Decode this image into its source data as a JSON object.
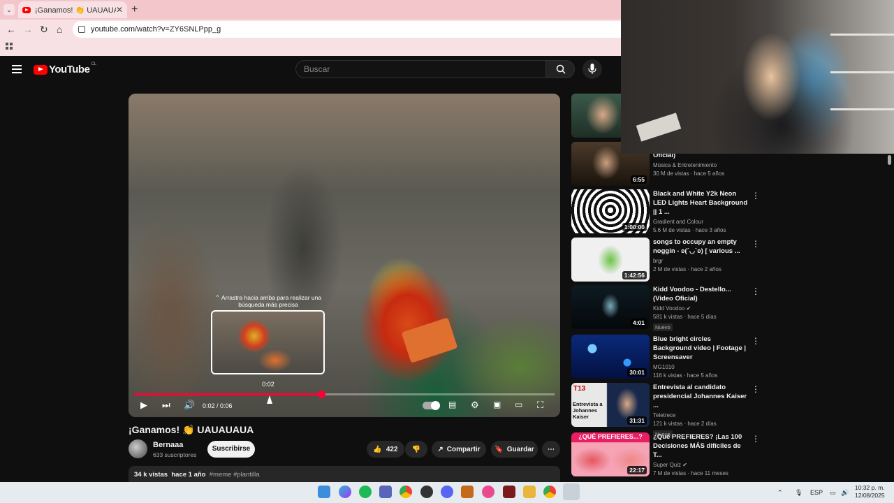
{
  "browser": {
    "tab_title": "¡Ganamos! 👏 UAUAUAUA - YouTube",
    "tab_close": "✕",
    "new_tab": "+",
    "url": "youtube.com/watch?v=ZY6SNLPpp_g"
  },
  "header": {
    "logo_text": "YouTube",
    "country": "CL",
    "search_placeholder": "Buscar"
  },
  "player": {
    "drag_hint": "⌃ Arrastra hacia arriba para realizar una búsqueda más precisa",
    "hover_time": "0:02",
    "timecode": "0:02 / 0:06",
    "progress": 0.445
  },
  "video": {
    "title": "¡Ganamos! 👏 UAUAUAUA",
    "channel": "Bernaaa",
    "subscribers": "633 suscriptores",
    "subscribe_label": "Suscribirse",
    "likes": "422",
    "share_label": "Compartir",
    "save_label": "Guardar",
    "views": "34 k vistas",
    "age": "hace 1 año",
    "tags": "#meme #plantilla"
  },
  "sidebar": [
    {
      "title": "Oficial)",
      "channel": "Música & Entretenimiento",
      "views": "30 M de vistas · hace 5 años",
      "duration": "6:55",
      "badge": "",
      "partial": true
    },
    {
      "title": "Black and White Y2k Neon LED Lights Heart Background || 1 ...",
      "channel": "Gradient and Colour",
      "views": "5.6 M de vistas · hace 3 años",
      "duration": "1:00:00",
      "badge": ""
    },
    {
      "title": "songs to occupy an empty noggin - ʚ(´◡`ʚ) [ various ...",
      "channel": "brgr",
      "views": "2 M de vistas · hace 2 años",
      "duration": "1:42:56",
      "badge": ""
    },
    {
      "title": "Kidd Voodoo - Destello... (Video Oficial)",
      "channel": "Kidd Voodoo ✔",
      "views": "581 k vistas · hace 5 días",
      "duration": "4:01",
      "badge": "Nuevo"
    },
    {
      "title": "Blue bright circles Background video | Footage | Screensaver",
      "channel": "MG1010",
      "views": "116 k vistas · hace 5 años",
      "duration": "30:01",
      "badge": ""
    },
    {
      "title": "Entrevista al candidato presidencial Johannes Kaiser ...",
      "channel": "Teletrece",
      "views": "121 k vistas · hace 2 días",
      "duration": "31:31",
      "badge": "Nuevo"
    },
    {
      "title": "¿Qué PREFIERES? ¡Las 100 Decisiones MÁS difíciles de T...",
      "channel": "Super Quiz ✔",
      "views": "7 M de vistas · hace 11 meses",
      "duration": "22:17",
      "badge": ""
    }
  ],
  "thumb_texts": {
    "t13_logo": "T13",
    "t13_caption": "Entrevista a Johannes Kaiser",
    "quiz_caption": "¿QUÉ PREFIERES...?"
  },
  "taskbar": {
    "lang": "ESP",
    "time": "10:32 p. m.",
    "date": "12/08/2025"
  },
  "colors": {
    "accent": "#ff0033",
    "background": "#0f0f0f",
    "chrome_pink": "#f7e1e4"
  }
}
